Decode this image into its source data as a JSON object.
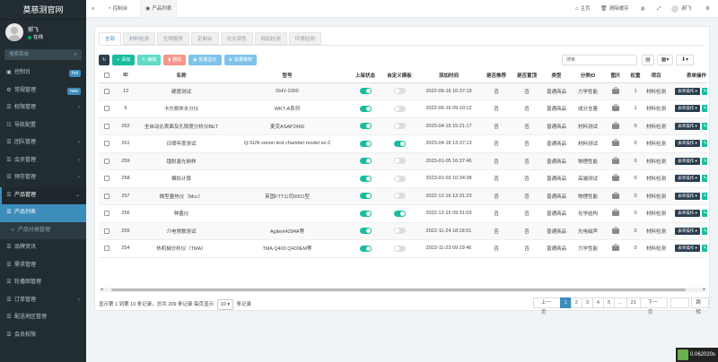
{
  "brand": "莫慈测官网",
  "user": {
    "name": "郝飞",
    "status": "在线"
  },
  "sidebar_search_placeholder": "搜索菜单",
  "nav": [
    {
      "label": "控制台",
      "icon": "▣",
      "badge": "hot",
      "badge_color": "#3c8dbc"
    },
    {
      "label": "常规管理",
      "icon": "⚙",
      "badge": "new",
      "badge_color": "#3c8dbc"
    },
    {
      "label": "权限管理",
      "icon": "☰",
      "chev": "‹"
    },
    {
      "label": "导航配置",
      "icon": "☷"
    },
    {
      "label": "团队管理",
      "icon": "☰",
      "chev": "‹"
    },
    {
      "label": "会员管理",
      "icon": "☰",
      "chev": "‹"
    },
    {
      "label": "预存管理",
      "icon": "☰",
      "chev": "‹"
    },
    {
      "label": "产品管理",
      "icon": "☰",
      "chev": "⌄",
      "state": "open"
    },
    {
      "label": "产品列表",
      "icon": "☰",
      "state": "active"
    },
    {
      "label": "产品分类管理",
      "icon": "○",
      "state": "sub"
    },
    {
      "label": "品牌资讯",
      "icon": "☰"
    },
    {
      "label": "需求管理",
      "icon": "☰"
    },
    {
      "label": "轮播图管理",
      "icon": "☰"
    },
    {
      "label": "订单管理",
      "icon": "☰",
      "chev": "‹"
    },
    {
      "label": "配送地区管理",
      "icon": "☰"
    },
    {
      "label": "会员权限",
      "icon": "☰"
    }
  ],
  "topbar": {
    "tab_console": "控制台",
    "tab_product_list": "产品列表",
    "home": "主页",
    "clear_cache": "清除缓存",
    "user_name": "郝飞"
  },
  "tabs": [
    "全部",
    "材料检测",
    "生物服务",
    "定制合",
    "论文润色",
    "网站检测",
    "环境检测"
  ],
  "toolbar": {
    "refresh": "↻",
    "add": "添加",
    "edit": "编辑",
    "delete": "删除",
    "batch_show": "批量显示",
    "batch_recommend": "批量推荐",
    "search_placeholder": "搜索"
  },
  "columns": [
    "",
    "ID",
    "名称",
    "型号",
    "上架状态",
    "自定义模板",
    "添加时间",
    "是否推荐",
    "是否置顶",
    "类型",
    "分类ID",
    "图片",
    "权重",
    "项目",
    "表单操作"
  ],
  "rows": [
    {
      "id": "13",
      "name": "硬度测试",
      "model": "DHV-1000",
      "listed": true,
      "custom": false,
      "time": "2022-06-16 16:37:19",
      "rec": "否",
      "top": "否",
      "type": "普通商品",
      "cat": "力学性能",
      "weight": "1",
      "project": "材料检测"
    },
    {
      "id": "6",
      "name": "卡尔费休水分仪",
      "model": "WKT-A系列",
      "listed": true,
      "custom": false,
      "time": "2022-06-16 09:10:12",
      "rec": "否",
      "top": "否",
      "type": "普通商品",
      "cat": "成分含量",
      "weight": "1",
      "project": "材料检测"
    },
    {
      "id": "262",
      "name": "全自动比表面及孔隙度分析仪BET",
      "model": "麦克ASAP2460",
      "listed": true,
      "custom": false,
      "time": "2023-04-19 15:21:17",
      "rec": "否",
      "top": "否",
      "type": "普通商品",
      "cat": "材料测试",
      "weight": "0",
      "project": "材料检测"
    },
    {
      "id": "261",
      "name": "日晒牢度测试",
      "model": "Q-SUN xenon test chamber model xe-2",
      "listed": true,
      "custom": true,
      "time": "2023-04-18 13:37:13",
      "rec": "否",
      "top": "否",
      "type": "普通商品",
      "cat": "材料测试",
      "weight": "0",
      "project": "材料检测"
    },
    {
      "id": "259",
      "name": "镭射激光制样",
      "model": "",
      "listed": true,
      "custom": false,
      "time": "2023-01-05 16:37:46",
      "rec": "否",
      "top": "否",
      "type": "普通商品",
      "cat": "物理性能",
      "weight": "0",
      "project": "材料检测"
    },
    {
      "id": "258",
      "name": "模拟计算",
      "model": "",
      "listed": true,
      "custom": false,
      "time": "2023-01-03 10:34:38",
      "rec": "否",
      "top": "否",
      "type": "普通商品",
      "cat": "高端测试",
      "weight": "0",
      "project": "材料检测"
    },
    {
      "id": "257",
      "name": "微型量热仪（Mcc）",
      "model": "英国FTT公司0001型",
      "listed": true,
      "custom": false,
      "time": "2022-12-16 13:31:23",
      "rec": "否",
      "top": "否",
      "type": "普通商品",
      "cat": "物理性能",
      "weight": "0",
      "project": "材料检测"
    },
    {
      "id": "256",
      "name": "种菌仪",
      "model": "",
      "listed": true,
      "custom": true,
      "time": "2022-12-15 09:31:03",
      "rec": "否",
      "top": "否",
      "type": "普通商品",
      "cat": "化学结构",
      "weight": "0",
      "project": "材料检测"
    },
    {
      "id": "255",
      "name": "介电常数测试",
      "model": "Agilent4294A等",
      "listed": true,
      "custom": false,
      "time": "2022-11-24 18:18:51",
      "rec": "否",
      "top": "否",
      "type": "普通商品",
      "cat": "光电磁声",
      "weight": "0",
      "project": "材料检测"
    },
    {
      "id": "254",
      "name": "热机械分析仪（TMA）",
      "model": "TMA Q400 Q400EM等",
      "listed": true,
      "custom": false,
      "time": "2022-11-23 09:19:46",
      "rec": "否",
      "top": "否",
      "type": "普通商品",
      "cat": "力学性能",
      "weight": "0",
      "project": "材料检测"
    }
  ],
  "row_ops_label": "表单操作",
  "pager": {
    "info_prefix": "显示第 1 到第 10 条记录，总共 209 条记录 每页显示",
    "page_size": "10",
    "info_suffix": "条记录",
    "prev": "上一页",
    "pages": [
      "1",
      "2",
      "3",
      "4",
      "5",
      "...",
      "21"
    ],
    "current": "1",
    "next": "下一页",
    "jump": "跳转"
  },
  "timer": "0.062020s"
}
